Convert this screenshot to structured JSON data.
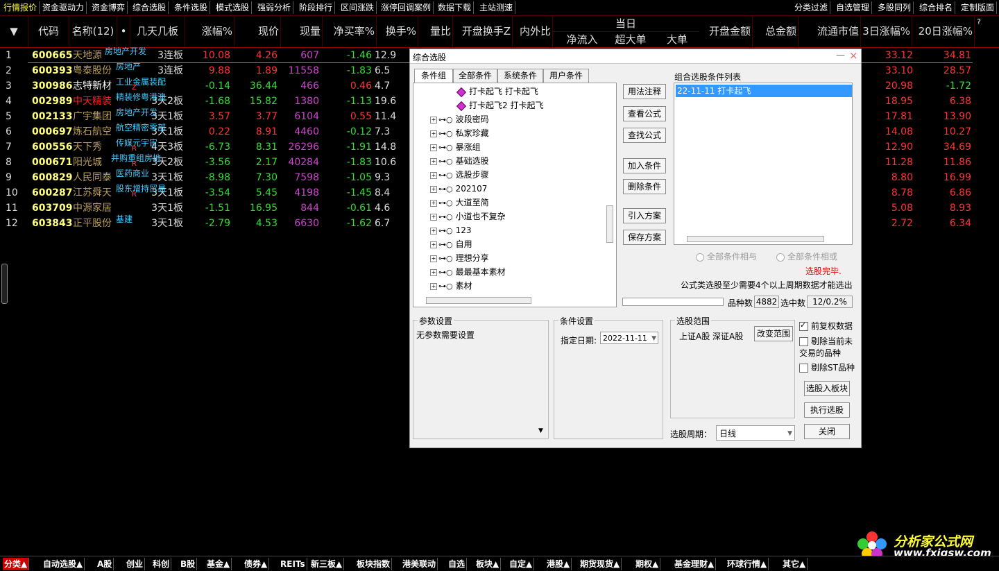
{
  "top_menu": [
    "行情报价",
    "资金驱动力",
    "资金博弈",
    "综合选股",
    "条件选股",
    "模式选股",
    "强弱分析",
    "阶段排行",
    "区间涨跌",
    "涨停回调案例",
    "数据下载",
    "主站测速"
  ],
  "top_menu_right": [
    "分类过滤",
    "自选管理",
    "多股同列",
    "综合排名",
    "定制版面"
  ],
  "header": {
    "dropdown": "▼",
    "code": "代码",
    "name": "名称(12)",
    "dot": "•",
    "days": "几天几板",
    "change": "涨幅%",
    "price": "现价",
    "volume": "现量",
    "net_buy": "净买率%",
    "turnover": "换手%",
    "vol_ratio": "量比",
    "open_turnover": "开盘换手Z",
    "inout": "内外比",
    "today": "当日",
    "net_inflow": "净流入",
    "super_large": "超大单",
    "large": "大单",
    "open_amount": "开盘金额",
    "total_amount": "总金额",
    "float_mv": "流通市值",
    "chg3": "3日涨幅%",
    "chg20": "20日涨幅%",
    "help": "?"
  },
  "rows": [
    {
      "idx": "1",
      "code": "600665",
      "name": "天地源",
      "tag": "房地产开发",
      "days": "3连板",
      "chg": "10.08",
      "price": "4.26",
      "vol": "607",
      "net": "-1.46",
      "turn": "12.9",
      "c3": "33.12",
      "c20": "34.81",
      "chgc": "r",
      "pricec": "r",
      "netc": "g",
      "c20c": "r",
      "namec": "",
      "tagmark": ""
    },
    {
      "idx": "2",
      "code": "600393",
      "name": "粤泰股份",
      "tag": "房地产",
      "days": "3连板",
      "chg": "9.88",
      "price": "1.89",
      "vol": "11558",
      "net": "-1.83",
      "turn": "6.5",
      "c3": "33.10",
      "c20": "28.57",
      "chgc": "r",
      "pricec": "r",
      "netc": "g",
      "c20c": "r",
      "namec": "",
      "tagmark": ""
    },
    {
      "idx": "3",
      "code": "300986",
      "name": "志特新材",
      "tag": "工业金属装配",
      "days": "",
      "chg": "-0.14",
      "price": "36.44",
      "vol": "466",
      "net": "0.46",
      "turn": "4.7",
      "c3": "20.98",
      "c20": "-1.72",
      "chgc": "g",
      "pricec": "g",
      "netc": "r",
      "c20c": "g",
      "namec": "white",
      "tagmark": "Z"
    },
    {
      "idx": "4",
      "code": "002989",
      "name": "中天精装",
      "tag": "精装修粤港澳",
      "days": "3天2板",
      "chg": "-1.68",
      "price": "15.82",
      "vol": "1380",
      "net": "-1.13",
      "turn": "19.6",
      "c3": "18.95",
      "c20": "6.38",
      "chgc": "g",
      "pricec": "g",
      "netc": "g",
      "c20c": "r",
      "namec": "hl",
      "tagmark": ""
    },
    {
      "idx": "5",
      "code": "002133",
      "name": "广宇集团",
      "tag": "房地产开发",
      "days": "3天1板",
      "chg": "3.57",
      "price": "3.77",
      "vol": "6104",
      "net": "0.55",
      "turn": "11.4",
      "c3": "17.81",
      "c20": "13.90",
      "chgc": "r",
      "pricec": "r",
      "netc": "r",
      "c20c": "r",
      "namec": "",
      "tagmark": ""
    },
    {
      "idx": "6",
      "code": "000697",
      "name": "炼石航空",
      "tag": "航空精密零部",
      "days": "3天1板",
      "chg": "0.22",
      "price": "8.91",
      "vol": "4460",
      "net": "-0.12",
      "turn": "7.3",
      "c3": "14.08",
      "c20": "10.27",
      "chgc": "r",
      "pricec": "r",
      "netc": "g",
      "c20c": "r",
      "namec": "",
      "tagmark": ""
    },
    {
      "idx": "7",
      "code": "600556",
      "name": "天下秀",
      "tag": "传媒元宇宙",
      "days": "4天3板",
      "chg": "-6.73",
      "price": "8.31",
      "vol": "26296",
      "net": "-1.91",
      "turn": "14.8",
      "c3": "12.90",
      "c20": "34.69",
      "chgc": "g",
      "pricec": "g",
      "netc": "g",
      "c20c": "r",
      "namec": "",
      "tagmark": "R"
    },
    {
      "idx": "8",
      "code": "000671",
      "name": "阳光城",
      "tag": "并购重组房地",
      "days": "3天2板",
      "chg": "-3.56",
      "price": "2.17",
      "vol": "40284",
      "net": "-1.83",
      "turn": "10.6",
      "c3": "11.28",
      "c20": "11.86",
      "chgc": "g",
      "pricec": "g",
      "netc": "g",
      "c20c": "r",
      "namec": "",
      "tagmark": "R"
    },
    {
      "idx": "9",
      "code": "600829",
      "name": "人民同泰",
      "tag": "医药商业",
      "days": "3天1板",
      "chg": "-8.98",
      "price": "7.30",
      "vol": "7598",
      "net": "-1.05",
      "turn": "9.3",
      "c3": "8.80",
      "c20": "16.99",
      "chgc": "g",
      "pricec": "g",
      "netc": "g",
      "c20c": "r",
      "namec": "",
      "tagmark": ""
    },
    {
      "idx": "10",
      "code": "600287",
      "name": "江苏舜天",
      "tag": "股东增持贸易",
      "days": "3天1板",
      "chg": "-3.54",
      "price": "5.45",
      "vol": "4198",
      "net": "-1.45",
      "turn": "8.4",
      "c3": "8.78",
      "c20": "6.86",
      "chgc": "g",
      "pricec": "g",
      "netc": "g",
      "c20c": "r",
      "namec": "",
      "tagmark": "R"
    },
    {
      "idx": "11",
      "code": "603709",
      "name": "中源家居",
      "tag": "",
      "days": "3天1板",
      "chg": "-1.51",
      "price": "16.95",
      "vol": "844",
      "net": "-0.61",
      "turn": "4.6",
      "c3": "5.08",
      "c20": "8.93",
      "chgc": "g",
      "pricec": "g",
      "netc": "g",
      "c20c": "r",
      "namec": "",
      "tagmark": ""
    },
    {
      "idx": "12",
      "code": "603843",
      "name": "正平股份",
      "tag": "基建",
      "days": "3天1板",
      "chg": "-2.79",
      "price": "4.53",
      "vol": "6630",
      "net": "-1.62",
      "turn": "6.7",
      "c3": "2.72",
      "c20": "6.34",
      "chgc": "g",
      "pricec": "g",
      "netc": "g",
      "c20c": "r",
      "namec": "",
      "tagmark": ""
    }
  ],
  "dialog": {
    "title": "综合选股",
    "min": "—",
    "close": "×",
    "tabs": [
      "条件组",
      "全部条件",
      "系统条件",
      "用户条件"
    ],
    "tree": [
      {
        "label": "打卡起飞  打卡起飞",
        "leaf": true
      },
      {
        "label": "打卡起飞2  打卡起飞",
        "leaf": true
      },
      {
        "label": "波段密码"
      },
      {
        "label": "私家珍藏"
      },
      {
        "label": "暴涨组"
      },
      {
        "label": "基础选股"
      },
      {
        "label": "选股步骤"
      },
      {
        "label": "202107"
      },
      {
        "label": "大道至简"
      },
      {
        "label": "小道也不复杂"
      },
      {
        "label": "123"
      },
      {
        "label": "自用"
      },
      {
        "label": "理想分享"
      },
      {
        "label": "最最基本素材"
      },
      {
        "label": "素材"
      }
    ],
    "buttons": {
      "usage": "用法注释",
      "view_formula": "查看公式",
      "find_formula": "查找公式",
      "add_cond": "加入条件",
      "del_cond": "删除条件",
      "import_plan": "引入方案",
      "save_plan": "保存方案"
    },
    "cond_list_title": "组合选股条件列表",
    "cond_list": [
      "22-11-11 打卡起飞"
    ],
    "radio_and": "全部条件相与",
    "radio_or": "全部条件相或",
    "status": "选股完毕.",
    "note": "公式类选股至少需要4个以上周期数据才能选出",
    "count_label": "品种数",
    "count_value": "4882",
    "selected_label": "选中数",
    "selected_value": "12/0.2%",
    "param_title": "参数设置",
    "param_text": "无参数需要设置",
    "cond_title": "条件设置",
    "date_label": "指定日期:",
    "date_value": "2022-11-11",
    "range_title": "选股范围",
    "range_text": "上证A股 深证A股",
    "change_range": "改变范围",
    "period_label": "选股周期：",
    "period_value": "日线",
    "chk_fq": "前复权数据",
    "chk_excl_untraded": "剔除当前未\n交易的品种",
    "chk_excl_st": "剔除ST品种",
    "to_board": "选股入板块",
    "execute": "执行选股",
    "close_btn": "关闭"
  },
  "bottom_tabs": [
    "分类▲",
    "自动选股▲",
    "A股",
    "创业",
    "科创",
    "B股",
    "基金▲",
    "债券▲",
    "REITs",
    "新三板▲",
    "板块指数",
    "港美联动",
    "自选",
    "板块▲",
    "自定▲",
    "港股▲",
    "期货现货▲",
    "期权▲",
    "基金理财▲",
    "环球行情▲",
    "其它▲"
  ],
  "watermark": {
    "title": "分析家公式网",
    "url": "www.fxjgsw.com"
  }
}
